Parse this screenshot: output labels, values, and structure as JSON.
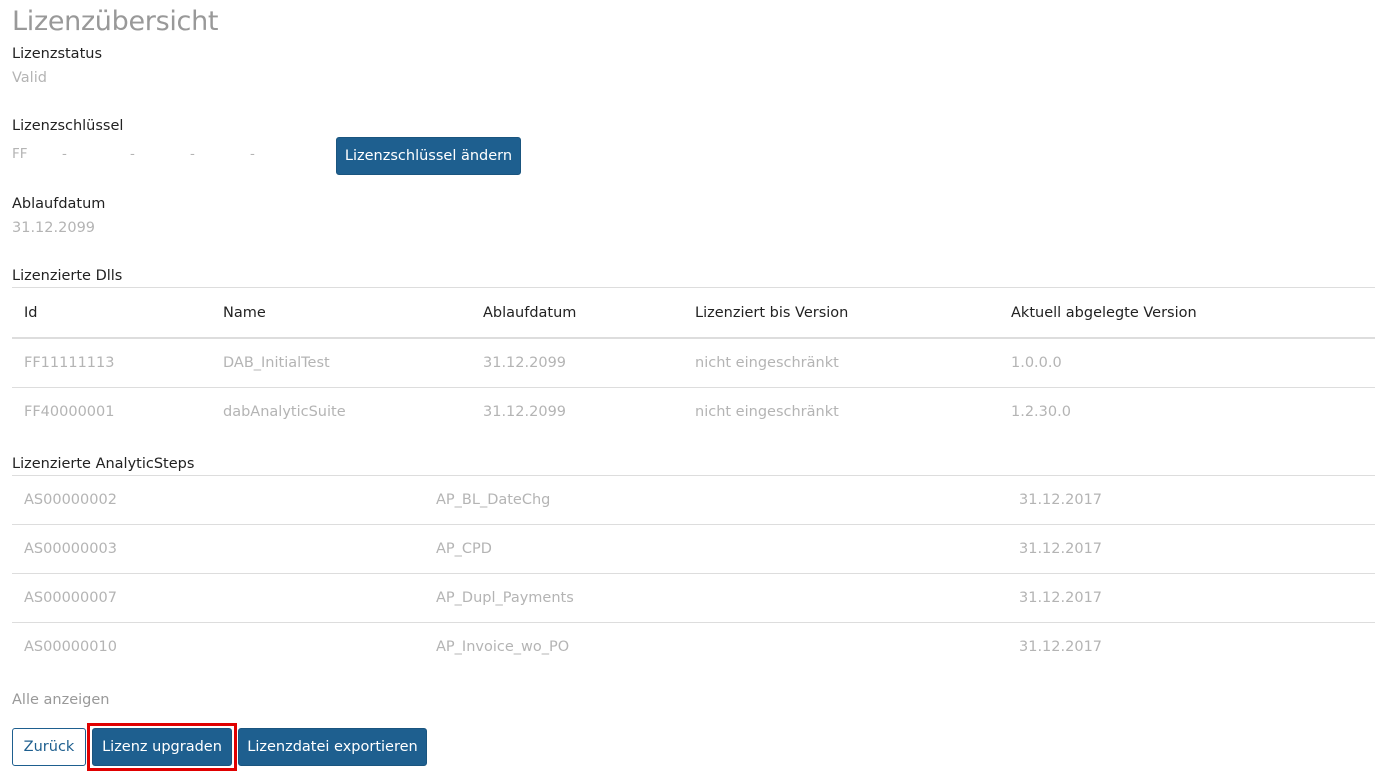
{
  "page": {
    "title": "Lizenzübersicht"
  },
  "status": {
    "label": "Lizenzstatus",
    "value": "Valid"
  },
  "license_key": {
    "label": "Lizenzschlüssel",
    "parts": [
      "FF",
      "-",
      "-",
      "-",
      "-"
    ],
    "change_button": "Lizenzschlüssel ändern"
  },
  "expiry": {
    "label": "Ablaufdatum",
    "value": "31.12.2099"
  },
  "dlls": {
    "label": "Lizenzierte Dlls",
    "columns": [
      "Id",
      "Name",
      "Ablaufdatum",
      "Lizenziert bis Version",
      "Aktuell abgelegte Version"
    ],
    "rows": [
      [
        "FF11111113",
        "DAB_InitialTest",
        "31.12.2099",
        "nicht eingeschränkt",
        "1.0.0.0"
      ],
      [
        "FF40000001",
        "dabAnalyticSuite",
        "31.12.2099",
        "nicht eingeschränkt",
        "1.2.30.0"
      ]
    ]
  },
  "steps": {
    "label": "Lizenzierte AnalyticSteps",
    "rows": [
      [
        "AS00000002",
        "AP_BL_DateChg",
        "31.12.2017"
      ],
      [
        "AS00000003",
        "AP_CPD",
        "31.12.2017"
      ],
      [
        "AS00000007",
        "AP_Dupl_Payments",
        "31.12.2017"
      ],
      [
        "AS00000010",
        "AP_Invoice_wo_PO",
        "31.12.2017"
      ]
    ],
    "show_all": "Alle anzeigen"
  },
  "actions": {
    "back": "Zurück",
    "upgrade": "Lizenz upgraden",
    "export": "Lizenzdatei exportieren"
  },
  "colors": {
    "primary": "#1e5f8f",
    "highlight": "#e00000",
    "muted": "#b4b4b4"
  }
}
